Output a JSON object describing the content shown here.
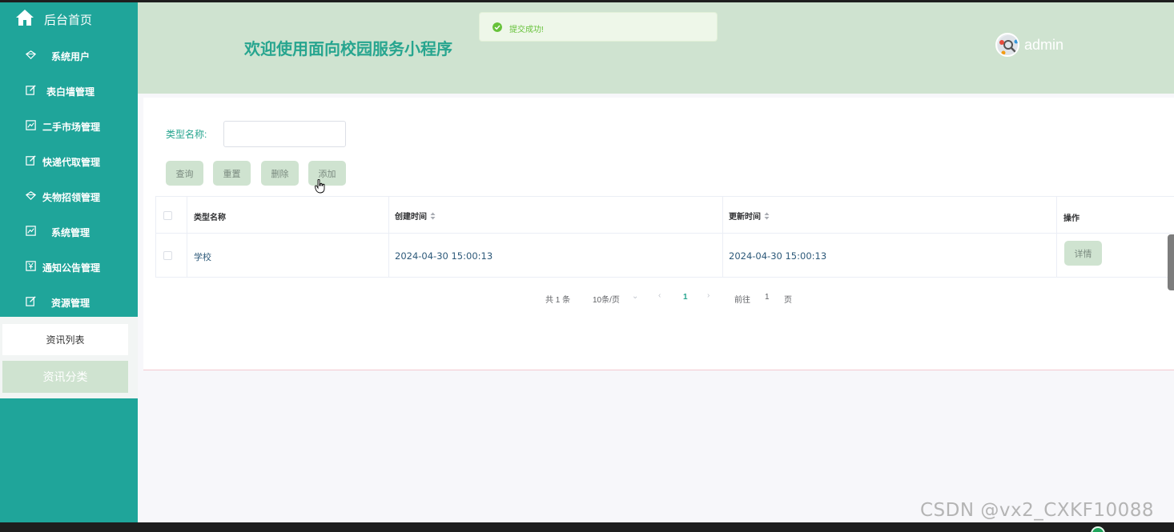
{
  "sidebar": {
    "home_label": "后台首页",
    "items": [
      {
        "label": "系统用户",
        "icon": "diamond-icon"
      },
      {
        "label": "表白墙管理",
        "icon": "edit-icon"
      },
      {
        "label": "二手市场管理",
        "icon": "chart-icon"
      },
      {
        "label": "快递代取管理",
        "icon": "edit-icon"
      },
      {
        "label": "失物招领管理",
        "icon": "diamond-icon"
      },
      {
        "label": "系统管理",
        "icon": "chart-icon"
      },
      {
        "label": "通知公告管理",
        "icon": "yen-icon"
      },
      {
        "label": "资源管理",
        "icon": "edit-icon"
      }
    ],
    "submenu": [
      {
        "label": "资讯列表"
      },
      {
        "label": "资讯分类"
      }
    ]
  },
  "header": {
    "title": "欢迎使用面向校园服务小程序",
    "username": "admin"
  },
  "toast": {
    "message": "提交成功!"
  },
  "filter": {
    "label": "类型名称:",
    "value": "",
    "placeholder": ""
  },
  "buttons": {
    "query": "查询",
    "reset": "重置",
    "delete": "删除",
    "add": "添加"
  },
  "table": {
    "columns": [
      "类型名称",
      "创建时间",
      "更新时间",
      "操作"
    ],
    "rows": [
      {
        "name": "学校",
        "created": "2024-04-30 15:00:13",
        "updated": "2024-04-30 15:00:13",
        "action": "详情"
      }
    ]
  },
  "pagination": {
    "total": "共 1 条",
    "page_size": "10条/页",
    "current": "1",
    "goto_prefix": "前往",
    "goto_value": "1",
    "goto_suffix": "页"
  },
  "watermark": "CSDN @vx2_CXKF10088",
  "colors": {
    "sidebar": "#1fa59a",
    "header": "#cfe3d0",
    "accent": "#27a58f",
    "button": "#cfe3d0"
  }
}
